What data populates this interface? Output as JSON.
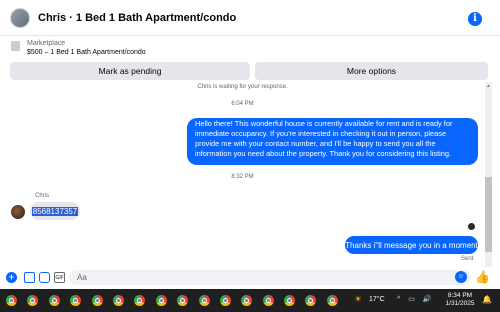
{
  "header": {
    "title": "Chris · 1 Bed 1 Bath Apartment/condo",
    "info_icon": "info-icon"
  },
  "marketplace": {
    "label": "Marketplace",
    "listing": "$500 – 1 Bed 1 Bath Apartment/condo",
    "mark_pending": "Mark as pending",
    "more_options": "More options"
  },
  "chat": {
    "waiting_notice": "Chris is waiting for your response.",
    "time_1": "6:04 PM",
    "outgoing_1": "Hello there! This wonderful house is currently available for rent and is ready for immediate occupancy. If you're interested in checking it out in person, please provide me with your contact number, and I'll be happy to send you all the information you need about the property. Thank you for considering this listing.",
    "time_2": "8:32 PM",
    "sender_name": "Chris",
    "incoming_1": "8568137357",
    "outgoing_2": "Thanks i\"ll message you in a moment",
    "status": "Sent"
  },
  "composer": {
    "placeholder": "Aa"
  },
  "taskbar": {
    "apps": [
      "chrome",
      "chrome",
      "chrome",
      "chrome",
      "chrome",
      "chrome",
      "chrome",
      "chrome",
      "chrome",
      "chrome",
      "chrome",
      "chrome",
      "chrome",
      "chrome",
      "chrome",
      "chrome"
    ],
    "temperature": "17°C",
    "time": "8:34 PM",
    "date": "1/31/2025"
  },
  "colors": {
    "accent": "#0866ff",
    "bubble_in": "#e4e6eb",
    "taskbar": "#1f1f1f"
  }
}
